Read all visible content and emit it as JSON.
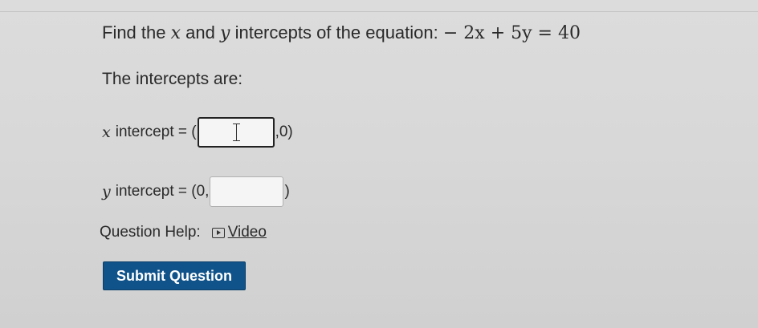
{
  "question": {
    "prefix": "Find the",
    "var_x": "x",
    "middle": "and",
    "var_y": "y",
    "suffix": "intercepts of the equation:",
    "equation": "− 2x + 5y = 40"
  },
  "intro": "The intercepts are:",
  "x_intercept": {
    "var": "x",
    "label": "intercept = (",
    "after_box": ",0)",
    "value": ""
  },
  "y_intercept": {
    "var": "y",
    "label": "intercept = (0,",
    "after_box": ")",
    "value": ""
  },
  "help": {
    "label": "Question Help:",
    "video_link": "Video"
  },
  "submit": {
    "label": "Submit Question"
  },
  "colors": {
    "submit_bg": "#10538a",
    "submit_text": "#ffffff"
  },
  "icons": {
    "video": "play-icon"
  }
}
